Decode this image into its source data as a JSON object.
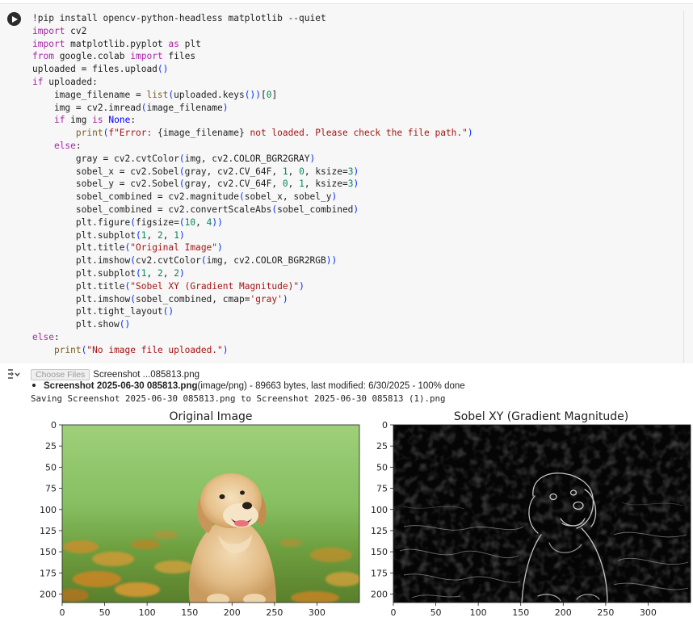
{
  "cell": {
    "run_button_label": "Run cell",
    "code_lines": [
      [
        [
          "cm",
          "!pip install opencv-python-headless matplotlib --quiet"
        ]
      ],
      [
        [
          "kw",
          "import"
        ],
        [
          "cm",
          " cv2"
        ]
      ],
      [
        [
          "kw",
          "import"
        ],
        [
          "cm",
          " matplotlib.pyplot "
        ],
        [
          "kw",
          "as"
        ],
        [
          "cm",
          " plt"
        ]
      ],
      [
        [
          "kw",
          "from"
        ],
        [
          "cm",
          " google.colab "
        ],
        [
          "kw",
          "import"
        ],
        [
          "cm",
          " files"
        ]
      ],
      [
        [
          "cm",
          "uploaded = files.upload"
        ],
        [
          "cb",
          "()"
        ]
      ],
      [
        [
          "kw",
          "if"
        ],
        [
          "cm",
          " uploaded:"
        ]
      ],
      [
        [
          "cm",
          "    image_filename = "
        ],
        [
          "fn",
          "list"
        ],
        [
          "cb",
          "("
        ],
        [
          "cm",
          "uploaded.keys"
        ],
        [
          "cb",
          "()"
        ],
        [
          "cb",
          ")"
        ],
        [
          "cm",
          "["
        ],
        [
          "nm",
          "0"
        ],
        [
          "cm",
          "]"
        ]
      ],
      [
        [
          "cm",
          "    img = cv2.imread"
        ],
        [
          "cb",
          "("
        ],
        [
          "cm",
          "image_filename"
        ],
        [
          "cb",
          ")"
        ]
      ],
      [
        [
          "cm",
          "    "
        ],
        [
          "kw",
          "if"
        ],
        [
          "cm",
          " img "
        ],
        [
          "kw",
          "is"
        ],
        [
          "cm",
          " "
        ],
        [
          "bi",
          "None"
        ],
        [
          "cm",
          ":"
        ]
      ],
      [
        [
          "cm",
          "        "
        ],
        [
          "fn",
          "print"
        ],
        [
          "cb",
          "("
        ],
        [
          "st",
          "f\"Error: "
        ],
        [
          "cm",
          "{image_filename}"
        ],
        [
          "st",
          " not loaded. Please check the file path.\""
        ],
        [
          "cb",
          ")"
        ]
      ],
      [
        [
          "cm",
          "    "
        ],
        [
          "kw",
          "else"
        ],
        [
          "cm",
          ":"
        ]
      ],
      [
        [
          "cm",
          "        gray = cv2.cvtColor"
        ],
        [
          "cb",
          "("
        ],
        [
          "cm",
          "img, cv2.COLOR_BGR2GRAY"
        ],
        [
          "cb",
          ")"
        ]
      ],
      [
        [
          "cm",
          "        sobel_x = cv2.Sobel"
        ],
        [
          "cb",
          "("
        ],
        [
          "cm",
          "gray, cv2.CV_64F, "
        ],
        [
          "nm",
          "1"
        ],
        [
          "cm",
          ", "
        ],
        [
          "nm",
          "0"
        ],
        [
          "cm",
          ", ksize="
        ],
        [
          "nm",
          "3"
        ],
        [
          "cb",
          ")"
        ]
      ],
      [
        [
          "cm",
          "        sobel_y = cv2.Sobel"
        ],
        [
          "cb",
          "("
        ],
        [
          "cm",
          "gray, cv2.CV_64F, "
        ],
        [
          "nm",
          "0"
        ],
        [
          "cm",
          ", "
        ],
        [
          "nm",
          "1"
        ],
        [
          "cm",
          ", ksize="
        ],
        [
          "nm",
          "3"
        ],
        [
          "cb",
          ")"
        ]
      ],
      [
        [
          "cm",
          "        sobel_combined = cv2.magnitude"
        ],
        [
          "cb",
          "("
        ],
        [
          "cm",
          "sobel_x, sobel_y"
        ],
        [
          "cb",
          ")"
        ]
      ],
      [
        [
          "cm",
          "        sobel_combined = cv2.convertScaleAbs"
        ],
        [
          "cb",
          "("
        ],
        [
          "cm",
          "sobel_combined"
        ],
        [
          "cb",
          ")"
        ]
      ],
      [
        [
          "cm",
          "        plt.figure"
        ],
        [
          "cb",
          "("
        ],
        [
          "cm",
          "figsize="
        ],
        [
          "cb",
          "("
        ],
        [
          "nm",
          "10"
        ],
        [
          "cm",
          ", "
        ],
        [
          "nm",
          "4"
        ],
        [
          "cb",
          ")"
        ],
        [
          "cb",
          ")"
        ]
      ],
      [
        [
          "cm",
          "        plt.subplot"
        ],
        [
          "cb",
          "("
        ],
        [
          "nm",
          "1"
        ],
        [
          "cm",
          ", "
        ],
        [
          "nm",
          "2"
        ],
        [
          "cm",
          ", "
        ],
        [
          "nm",
          "1"
        ],
        [
          "cb",
          ")"
        ]
      ],
      [
        [
          "cm",
          "        plt.title"
        ],
        [
          "cb",
          "("
        ],
        [
          "st",
          "\"Original Image\""
        ],
        [
          "cb",
          ")"
        ]
      ],
      [
        [
          "cm",
          "        plt.imshow"
        ],
        [
          "cb",
          "("
        ],
        [
          "cm",
          "cv2.cvtColor"
        ],
        [
          "cb",
          "("
        ],
        [
          "cm",
          "img, cv2.COLOR_BGR2RGB"
        ],
        [
          "cb",
          ")"
        ],
        [
          "cb",
          ")"
        ]
      ],
      [
        [
          "cm",
          "        plt.subplot"
        ],
        [
          "cb",
          "("
        ],
        [
          "nm",
          "1"
        ],
        [
          "cm",
          ", "
        ],
        [
          "nm",
          "2"
        ],
        [
          "cm",
          ", "
        ],
        [
          "nm",
          "2"
        ],
        [
          "cb",
          ")"
        ]
      ],
      [
        [
          "cm",
          "        plt.title"
        ],
        [
          "cb",
          "("
        ],
        [
          "st",
          "\"Sobel XY (Gradient Magnitude)\""
        ],
        [
          "cb",
          ")"
        ]
      ],
      [
        [
          "cm",
          "        plt.imshow"
        ],
        [
          "cb",
          "("
        ],
        [
          "cm",
          "sobel_combined, cmap="
        ],
        [
          "st",
          "'gray'"
        ],
        [
          "cb",
          ")"
        ]
      ],
      [
        [
          "cm",
          "        plt.tight_layout"
        ],
        [
          "cb",
          "()"
        ]
      ],
      [
        [
          "cm",
          "        plt.show"
        ],
        [
          "cb",
          "()"
        ]
      ],
      [
        [
          "kw",
          "else"
        ],
        [
          "cm",
          ":"
        ]
      ],
      [
        [
          "cm",
          "    "
        ],
        [
          "fn",
          "print"
        ],
        [
          "cb",
          "("
        ],
        [
          "st",
          "\"No image file uploaded.\""
        ],
        [
          "cb",
          ")"
        ]
      ]
    ]
  },
  "output": {
    "choose_files_label": "Choose Files",
    "chosen_file_name": "Screenshot ...085813.png",
    "file_entry_name": "Screenshot 2025-06-30 085813.png",
    "file_entry_details": "(image/png) - 89663 bytes, last modified: 6/30/2025 - 100% done",
    "saving_message": "Saving Screenshot 2025-06-30 085813.png to Screenshot 2025-06-30 085813 (1).png"
  },
  "figure": {
    "left_title": "Original Image",
    "right_title": "Sobel XY (Gradient Magnitude)",
    "y_ticks": [
      "0",
      "25",
      "50",
      "75",
      "100",
      "125",
      "150",
      "175",
      "200"
    ],
    "x_ticks": [
      "0",
      "50",
      "100",
      "150",
      "200",
      "250",
      "300"
    ]
  },
  "colors": {
    "code_bg": "#f7f7f7",
    "keyword": "#a626a4",
    "string": "#a31515",
    "number": "#098658",
    "builtin": "#795e26",
    "constant": "#0000ff"
  }
}
